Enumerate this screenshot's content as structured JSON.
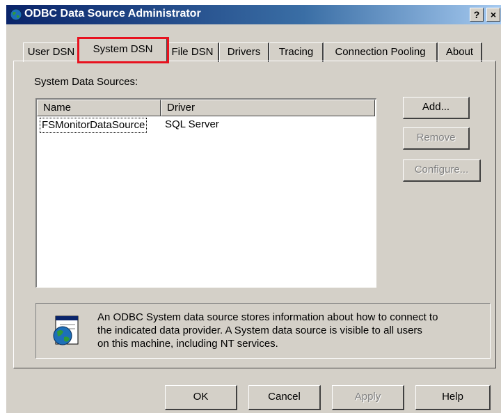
{
  "window": {
    "title": "ODBC Data Source Administrator",
    "help_button": "?",
    "close_button": "×"
  },
  "tabs": [
    {
      "label": "User DSN",
      "active": false
    },
    {
      "label": "System DSN",
      "active": true
    },
    {
      "label": "File DSN",
      "active": false
    },
    {
      "label": "Drivers",
      "active": false
    },
    {
      "label": "Tracing",
      "active": false
    },
    {
      "label": "Connection Pooling",
      "active": false
    },
    {
      "label": "About",
      "active": false
    }
  ],
  "system_dsn": {
    "group_label": "System Data Sources:",
    "columns": [
      "Name",
      "Driver"
    ],
    "rows": [
      {
        "name": "FSMonitorDataSource",
        "driver": "SQL Server"
      }
    ],
    "buttons": {
      "add": "Add...",
      "remove": "Remove",
      "configure": "Configure..."
    },
    "info_lines": [
      "An ODBC System data source stores information about how to connect to",
      "the indicated data provider.  A System data source is visible to all users",
      "on this machine, including NT services."
    ]
  },
  "footer": {
    "ok": "OK",
    "cancel": "Cancel",
    "apply": "Apply",
    "help": "Help"
  },
  "icons": {
    "title": "odbc-globe-icon",
    "info": "odbc-globe-document-icon"
  },
  "colors": {
    "dialog": "#d4d0c8",
    "titlebar_start": "#0a246a",
    "highlight": "#e8121f"
  }
}
